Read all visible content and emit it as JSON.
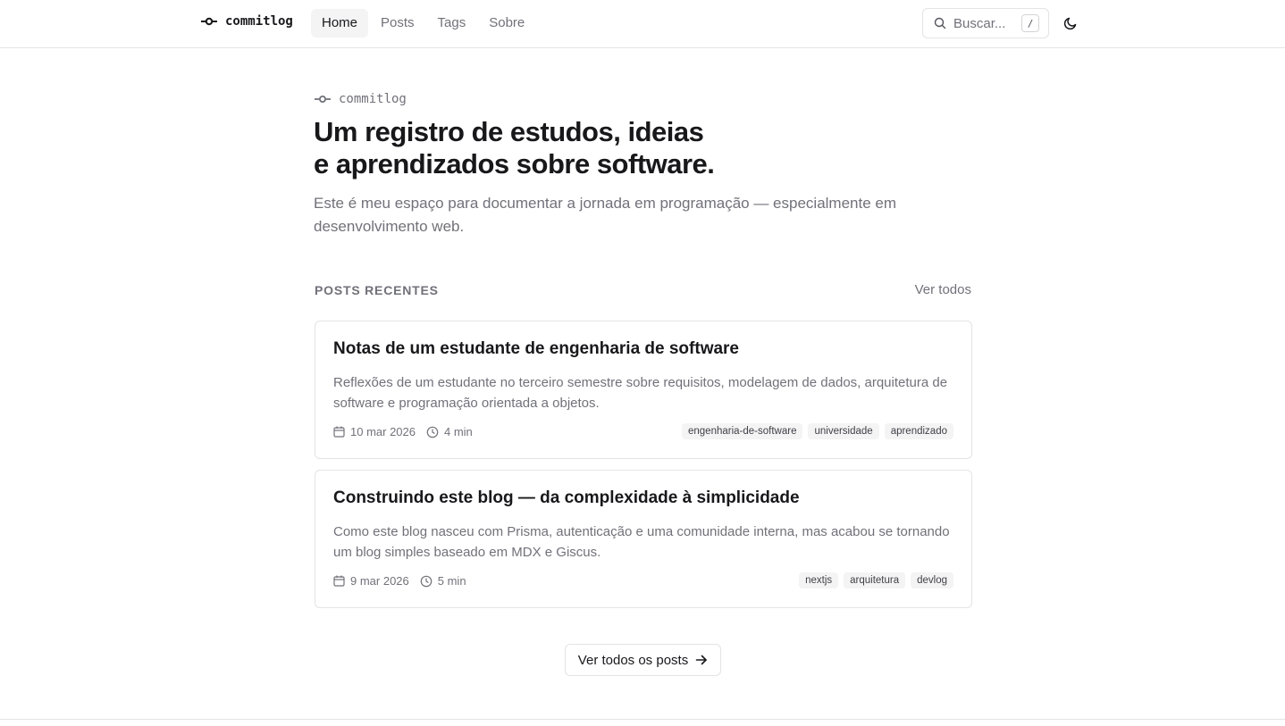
{
  "header": {
    "brand": "commitlog",
    "nav": [
      {
        "label": "Home",
        "active": true
      },
      {
        "label": "Posts",
        "active": false
      },
      {
        "label": "Tags",
        "active": false
      },
      {
        "label": "Sobre",
        "active": false
      }
    ],
    "search": {
      "placeholder": "Buscar...",
      "shortcut": "/"
    },
    "theme_toggle_icon": "moon-icon"
  },
  "hero": {
    "tag": "commitlog",
    "title_line1": "Um registro de estudos, ideias",
    "title_line2": "e aprendizados sobre software.",
    "subtitle": "Este é meu espaço para documentar a jornada em programação — especialmente em desenvolvimento web."
  },
  "recent": {
    "label": "POSTS RECENTES",
    "see_all": "Ver todos",
    "posts": [
      {
        "title": "Notas de um estudante de engenharia de software",
        "description": "Reflexões de um estudante no terceiro semestre sobre requisitos, modelagem de dados, arquitetura de software e programação orientada a objetos.",
        "date": "10 mar 2026",
        "read_time": "4 min",
        "tags": [
          "engenharia-de-software",
          "universidade",
          "aprendizado"
        ]
      },
      {
        "title": "Construindo este blog — da complexidade à simplicidade",
        "description": "Como este blog nasceu com Prisma, autenticação e uma comunidade interna, mas acabou se tornando um blog simples baseado em MDX e Giscus.",
        "date": "9 mar 2026",
        "read_time": "5 min",
        "tags": [
          "nextjs",
          "arquitetura",
          "devlog"
        ]
      }
    ],
    "cta": "Ver todos os posts"
  },
  "colors": {
    "text": "#18181b",
    "muted": "#71717a",
    "border": "#e4e4e7",
    "tag_bg": "#f4f4f5"
  }
}
